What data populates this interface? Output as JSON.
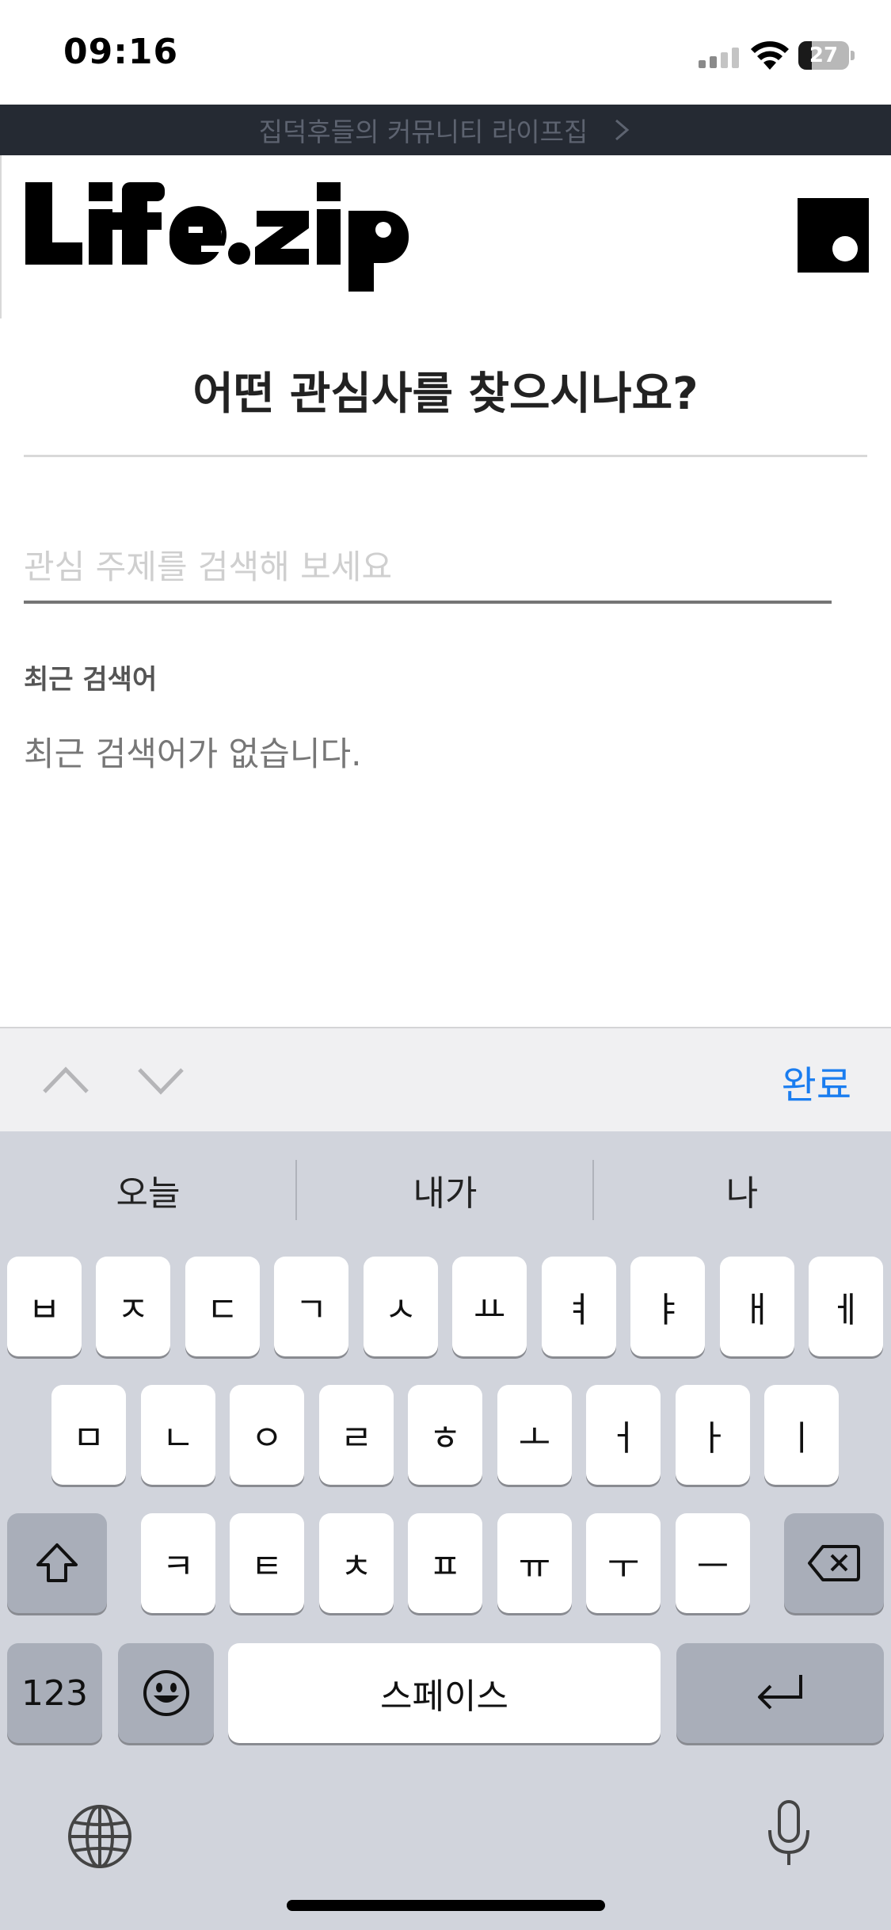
{
  "status_bar": {
    "time": "09:16",
    "battery_level": "27",
    "battery_fraction": 0.27
  },
  "banner": {
    "text": "집덕후들의 커뮤니티 라이프집"
  },
  "header": {
    "logo_text": "Life.zip"
  },
  "main": {
    "title": "어떤 관심사를 찾으시나요?",
    "search_placeholder": "관심 주제를 검색해 보세요",
    "search_value": "",
    "recent_label": "최근 검색어",
    "recent_empty": "최근 검색어가 없습니다."
  },
  "accessory": {
    "done_label": "완료"
  },
  "keyboard": {
    "suggestions": [
      "오늘",
      "내가",
      "나"
    ],
    "row1": [
      "ㅂ",
      "ㅈ",
      "ㄷ",
      "ㄱ",
      "ㅅ",
      "ㅛ",
      "ㅕ",
      "ㅑ",
      "ㅐ",
      "ㅔ"
    ],
    "row2": [
      "ㅁ",
      "ㄴ",
      "ㅇ",
      "ㄹ",
      "ㅎ",
      "ㅗ",
      "ㅓ",
      "ㅏ",
      "ㅣ"
    ],
    "row3": [
      "ㅋ",
      "ㅌ",
      "ㅊ",
      "ㅍ",
      "ㅠ",
      "ㅜ",
      "ㅡ"
    ],
    "numbers_label": "123",
    "space_label": "스페이스",
    "icons": {
      "shift": "shift-icon",
      "delete": "delete-icon",
      "emoji": "emoji-icon",
      "return": "return-icon",
      "globe": "globe-icon",
      "mic": "microphone-icon"
    }
  },
  "colors": {
    "accent": "#1a7df0",
    "banner_bg": "#252a33",
    "keyboard_bg": "#d1d4dc"
  }
}
